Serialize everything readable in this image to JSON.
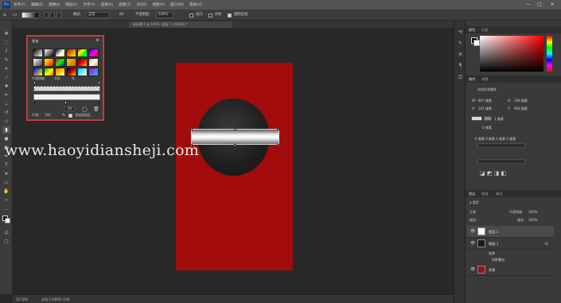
{
  "app": {
    "logo": "Ps",
    "menus": [
      "文件(F)",
      "编辑(E)",
      "图像(I)",
      "图层(L)",
      "文字(Y)",
      "选择(S)",
      "滤镜(T)",
      "3D(D)",
      "视图(V)",
      "窗口(W)",
      "帮助(H)"
    ],
    "window_controls": [
      "—",
      "□",
      "✕"
    ]
  },
  "options_bar": {
    "mode_label": "模式:",
    "mode_value": "正常",
    "opacity_label": "不透明度:",
    "opacity_value": "100%",
    "reverse_label": "反向",
    "dither_label": "仿色",
    "transparency_label": "透明区域",
    "small_values": [
      "80",
      "100"
    ]
  },
  "document": {
    "tab_title": "未标题-1 @ 100% (图层 1, RGB/8) *"
  },
  "watermark": "www.haoyidiansheji.com",
  "gradient_editor": {
    "title": "渐变",
    "swatches": [
      "linear-gradient(135deg,#000,#fff)",
      "linear-gradient(135deg,#fff,#000)",
      "linear-gradient(135deg,#000,#fff 60%,#ff0)",
      "linear-gradient(135deg,#c00,#ff0)",
      "linear-gradient(135deg,#f00,#ff0,#0f0,#0ff)",
      "linear-gradient(135deg,#00f,#f0f,#f00)",
      "linear-gradient(135deg,#fff,rgba(255,255,255,0))",
      "linear-gradient(135deg,#ff0,#f80,#f00)",
      "linear-gradient(135deg,#f00,#0f0,#00f)",
      "linear-gradient(135deg,#fc0,#c60)",
      "linear-gradient(135deg,#600,#f00,#fc0)",
      "linear-gradient(135deg,#d4af37,#fff,#d4af37)",
      "linear-gradient(135deg,#00f,#ff0)",
      "linear-gradient(135deg,#0a0,#ff0,#f60)",
      "linear-gradient(135deg,#f60,#fc0,#fff)",
      "linear-gradient(135deg,#000,#c00,#fc0)",
      "linear-gradient(135deg,#0cf,#fff)",
      "linear-gradient(135deg,#c0c,#0cf)"
    ],
    "opacity_label": "不透明度:",
    "opacity_value": "100",
    "opacity_unit": "%",
    "location_value": "50",
    "smoothness_label": "平滑:",
    "smoothness_value": "100",
    "smoothness_unit": "%",
    "add_to_selection_label": "添加到选区"
  },
  "right_panel": {
    "color_tab": "颜色",
    "swatches_tab": "色板",
    "properties_tab": "属性",
    "adjust_tab": "调整",
    "shape_props_label": "实时形状属性",
    "w_label": "W:",
    "w_value": "807 像素",
    "h_label": "H:",
    "h_value": "168 像素",
    "x_label": "X:",
    "x_value": "201 像素",
    "y_label": "Y:",
    "y_value": "906 像素",
    "stroke_value": "1 像素",
    "corners_value": "0 像素",
    "radius_row": "0 像素 0 像素 0 像素 0 像素",
    "layers_tab": "图层",
    "channels_tab": "通道",
    "paths_tab": "路径",
    "kind_label": "ρ 类型",
    "blend_mode": "正常",
    "opacity_label": "不透明度:",
    "opacity_value": "100%",
    "lock_label": "锁定:",
    "fill_label": "填充:",
    "fill_value": "100%",
    "layers": [
      {
        "name": "图层 1",
        "thumb": "#ffffff",
        "selected": true
      },
      {
        "name": "椭圆 1",
        "thumb": "#1a1a1a",
        "selected": false
      },
      {
        "name": "效果",
        "thumb": "",
        "selected": false,
        "sub": true
      },
      {
        "name": "投影叠加",
        "thumb": "",
        "selected": false,
        "sub": true
      },
      {
        "name": "背景",
        "thumb": "#a30c0c",
        "selected": false
      }
    ]
  },
  "status": {
    "zoom": "15.32%",
    "doc_info": "文档:5.93M/5.31M"
  }
}
